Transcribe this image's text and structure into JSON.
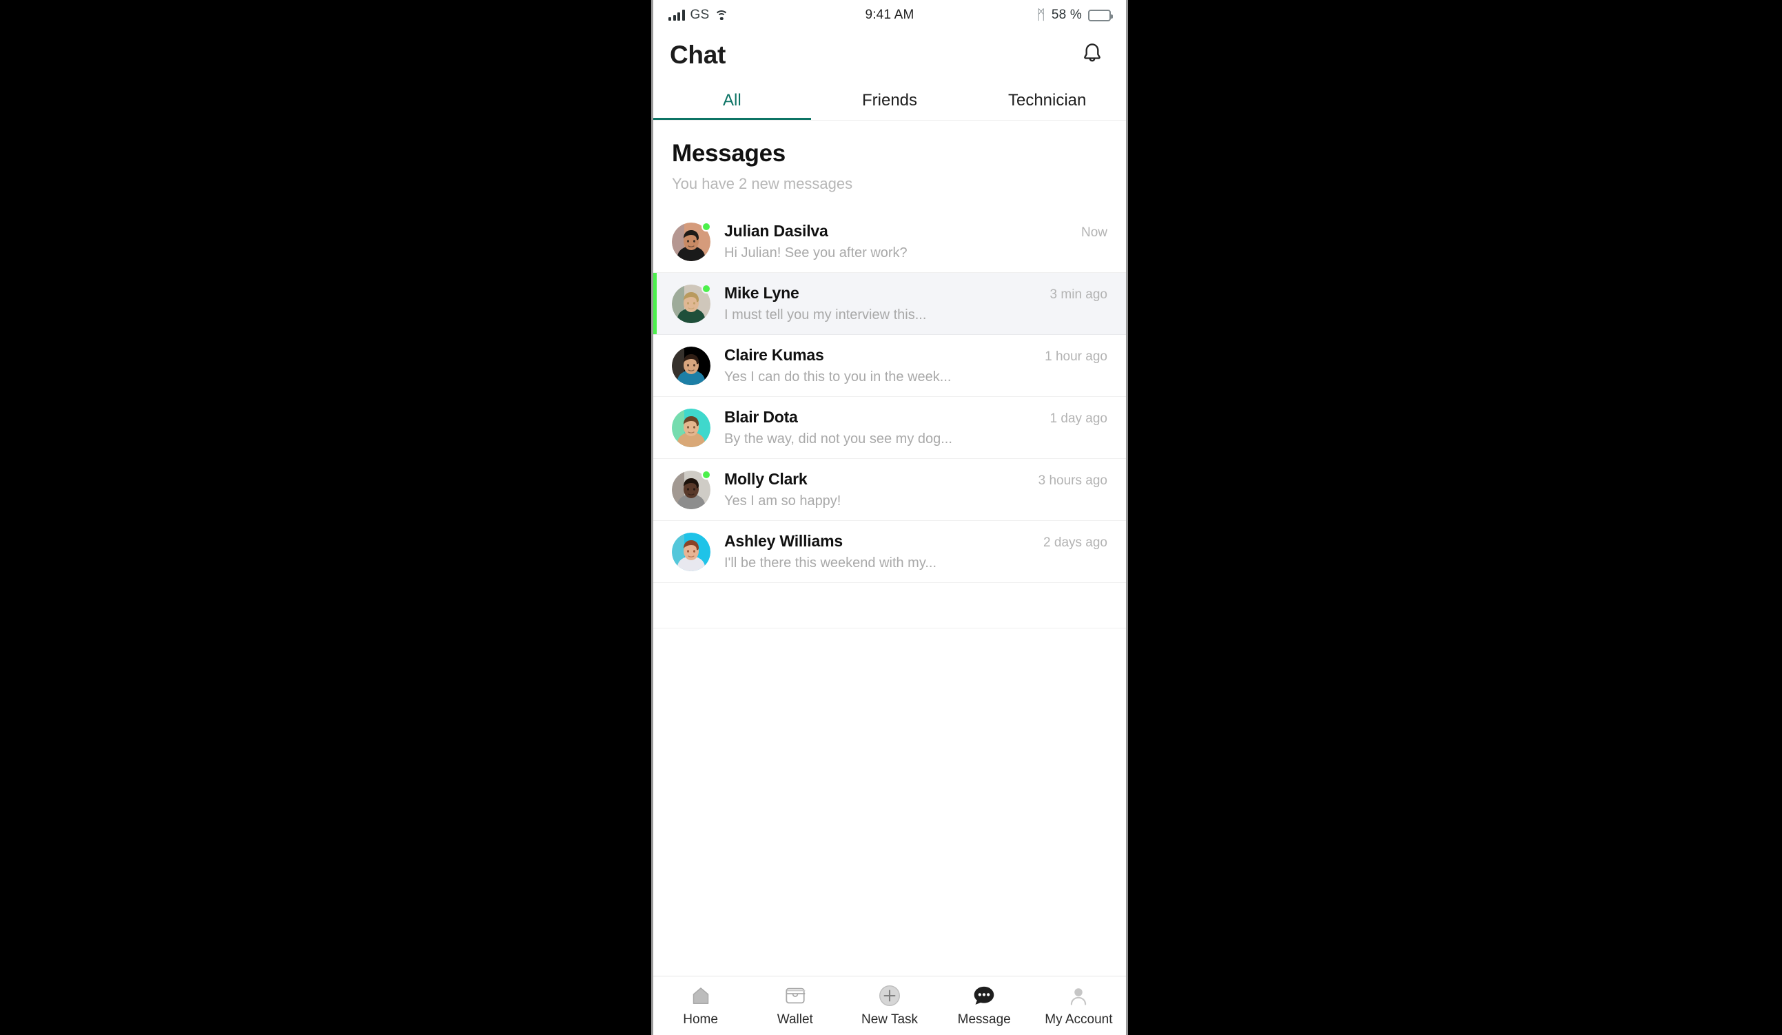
{
  "statusbar": {
    "carrier": "GS",
    "time": "9:41 AM",
    "battery_percent": "58 %",
    "battery_level": 58,
    "signal_icon": "cellular-signal-icon",
    "wifi_icon": "wifi-icon",
    "bluetooth_icon": "bluetooth-icon",
    "bluetooth_glyph": "ᛗ",
    "battery_icon": "battery-icon"
  },
  "header": {
    "title": "Chat",
    "bell_icon": "notification-bell-icon"
  },
  "tabs": [
    {
      "label": "All",
      "active": true
    },
    {
      "label": "Friends",
      "active": false
    },
    {
      "label": "Technician",
      "active": false
    }
  ],
  "section": {
    "title": "Messages",
    "subtitle": "You have 2 new messages"
  },
  "colors": {
    "accent_teal": "#0d7465",
    "online_green": "#4cf04c",
    "highlight_row_bg": "#f4f5f8",
    "muted_text": "#a9a9a9",
    "time_text": "#b3b3b3"
  },
  "messages": [
    {
      "name": "Julian Dasilva",
      "snippet": "Hi Julian! See you after work?",
      "time": "Now",
      "online": true,
      "highlighted": false,
      "avatar": {
        "bg": "#d59b7b",
        "skin": "#c98a64",
        "hair": "#1d1a17",
        "shirt": "#1a1a1a",
        "accent": "#6d8fc4"
      }
    },
    {
      "name": "Mike Lyne",
      "snippet": "I must tell you my interview this...",
      "time": "3 min ago",
      "online": true,
      "highlighted": true,
      "avatar": {
        "bg": "#cfc7bb",
        "skin": "#e0b894",
        "hair": "#b99a5e",
        "shirt": "#1f4f3a",
        "accent": "#2d6b4f"
      }
    },
    {
      "name": "Claire Kumas",
      "snippet": "Yes I can do this to you in the week...",
      "time": "1 hour ago",
      "online": false,
      "highlighted": false,
      "avatar": {
        "bg": "#b5a housing",
        "skin": "#d8a67f",
        "hair": "#2e1d14",
        "shirt": "#1d7fa6",
        "accent": "#b2a193"
      }
    },
    {
      "name": "Blair Dota",
      "snippet": "By the way, did not you see my dog...",
      "time": "1 day ago",
      "online": false,
      "highlighted": false,
      "avatar": {
        "bg": "#3fd8cc",
        "skin": "#e5b68e",
        "hair": "#6b4426",
        "shirt": "#d9a877",
        "accent": "#f2e36a"
      }
    },
    {
      "name": "Molly Clark",
      "snippet": "Yes I am so happy!",
      "time": "3 hours ago",
      "online": true,
      "highlighted": false,
      "avatar": {
        "bg": "#cfccc6",
        "skin": "#59392a",
        "hair": "#1c120c",
        "shirt": "#8d8d8d",
        "accent": "#3d261a"
      }
    },
    {
      "name": "Ashley Williams",
      "snippet": "I'll be there this weekend with my...",
      "time": "2 days ago",
      "online": false,
      "highlighted": false,
      "avatar": {
        "bg": "#1fc3e8",
        "skin": "#e8b494",
        "hair": "#8a4326",
        "shirt": "#e8e8ef",
        "accent": "#cfcfbb"
      }
    }
  ],
  "bottom_nav": [
    {
      "label": "Home",
      "icon": "home-icon",
      "active": false
    },
    {
      "label": "Wallet",
      "icon": "wallet-icon",
      "active": false
    },
    {
      "label": "New Task",
      "icon": "plus-circle-icon",
      "active": false
    },
    {
      "label": "Message",
      "icon": "message-bubble-icon",
      "active": true
    },
    {
      "label": "My Account",
      "icon": "user-account-icon",
      "active": false
    }
  ]
}
